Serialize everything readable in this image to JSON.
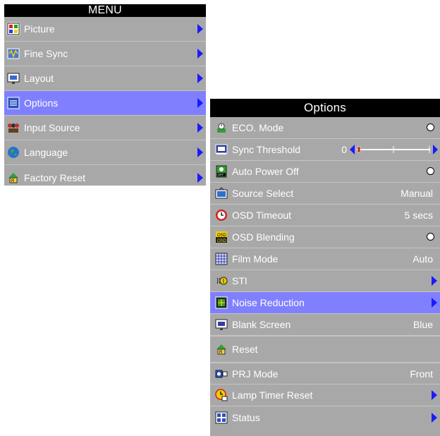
{
  "menu": {
    "title": "MENU",
    "items": [
      {
        "label": "Picture",
        "icon": "picture-icon"
      },
      {
        "label": "Fine Sync",
        "icon": "fine-sync-icon"
      },
      {
        "label": "Layout",
        "icon": "layout-icon"
      },
      {
        "label": "Options",
        "icon": "options-icon",
        "selected": true
      },
      {
        "label": "Input Source",
        "icon": "input-source-icon"
      },
      {
        "label": "Language",
        "icon": "language-icon"
      },
      {
        "label": "Factory Reset",
        "icon": "factory-reset-icon"
      }
    ]
  },
  "options": {
    "title": "Options",
    "items": [
      {
        "label": "ECO. Mode",
        "control": "radio"
      },
      {
        "label": "Sync Threshold",
        "control": "slider",
        "value": "0",
        "level": 0
      },
      {
        "label": "Auto Power Off",
        "control": "radio"
      },
      {
        "label": "Source Select",
        "control": "text",
        "value": "Manual"
      },
      {
        "label": "OSD Timeout",
        "control": "text",
        "value": "5 secs"
      },
      {
        "label": "OSD Blending",
        "control": "radio"
      },
      {
        "label": "Film Mode",
        "control": "text",
        "value": "Auto"
      },
      {
        "label": "STI",
        "control": "arrow"
      },
      {
        "label": "Noise Reduction",
        "control": "arrow",
        "selected": true
      },
      {
        "label": "Blank Screen",
        "control": "text",
        "value": "Blue"
      },
      {
        "label": "Reset",
        "control": "none"
      },
      {
        "label": "PRJ Mode",
        "control": "text",
        "value": "Front"
      },
      {
        "label": "Lamp Timer Reset",
        "control": "arrow"
      },
      {
        "label": "Status",
        "control": "arrow"
      }
    ]
  },
  "colors": {
    "panel": "#a8a8a8",
    "selected": "#8080ff",
    "arrow": "#1a1aff",
    "title_bar": "#000000"
  }
}
